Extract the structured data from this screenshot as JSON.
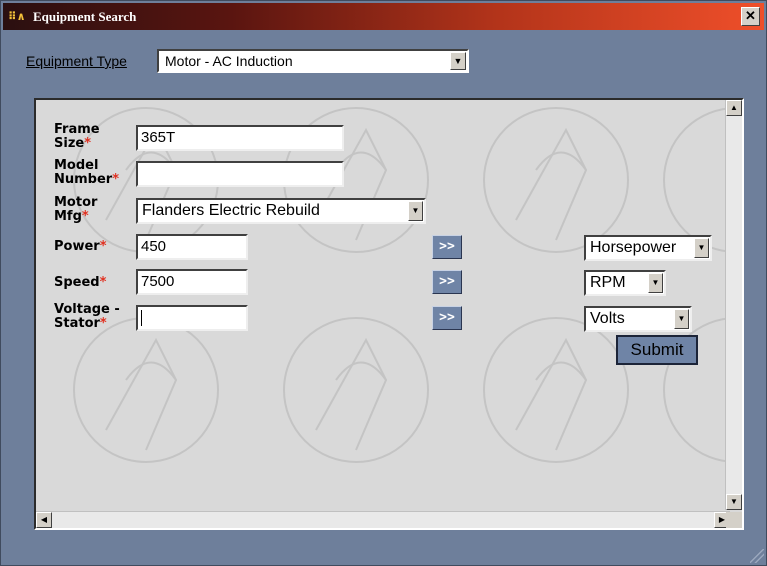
{
  "window": {
    "title": "Equipment Search",
    "close_label": "✕"
  },
  "equipment_type": {
    "label": "Equipment Type",
    "value": "Motor - AC Induction"
  },
  "form": {
    "frame_size": {
      "label_line1": "Frame",
      "label_line2": "Size",
      "required": "*",
      "value": "365T"
    },
    "model_number": {
      "label_line1": "Model",
      "label_line2": "Number",
      "required": "*",
      "value": ""
    },
    "motor_mfg": {
      "label_line1": "Motor",
      "label_line2": "Mfg",
      "required": "*",
      "value": "Flanders Electric Rebuild"
    },
    "power": {
      "label": "Power",
      "required": "*",
      "value": "450",
      "unit": "Horsepower"
    },
    "speed": {
      "label": "Speed",
      "required": "*",
      "value": "7500",
      "unit": "RPM"
    },
    "voltage_stator": {
      "label_line1": "Voltage -",
      "label_line2": "Stator",
      "required": "*",
      "value": "",
      "unit": "Volts"
    },
    "convert_label": ">>",
    "submit_label": "Submit"
  },
  "icons": {
    "app": "app-logo-icon",
    "dropdown": "dropdown-arrow-icon",
    "scroll_up": "scroll-up-icon",
    "scroll_down": "scroll-down-icon",
    "scroll_left": "scroll-left-icon",
    "scroll_right": "scroll-right-icon"
  },
  "colors": {
    "accent": "#6f84a6",
    "required": "#e03020",
    "title_gradient_end": "#ef4f2a"
  }
}
